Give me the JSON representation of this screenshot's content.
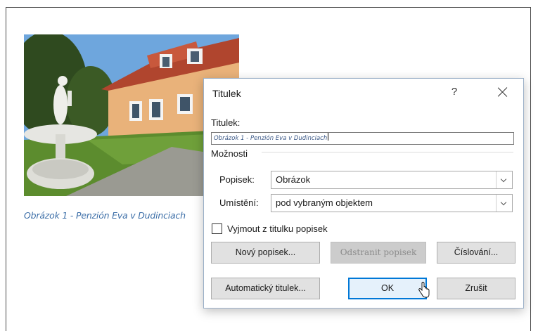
{
  "document": {
    "caption": "Obrázok 1 - Penzión Eva v Dudinciach"
  },
  "dialog": {
    "title": "Titulek",
    "help": "?",
    "caption_label": "Titulek:",
    "caption_value": "Obrázok 1 - Penzión Eva v Dudinciach",
    "options_label": "Možnosti",
    "label_field": {
      "label": "Popisek:",
      "value": "Obrázok"
    },
    "position_field": {
      "label": "Umístění:",
      "value": "pod vybraným objektem"
    },
    "exclude_label": {
      "label": "Vyjmout z titulku popisek",
      "checked": false
    },
    "buttons": {
      "new_label": "Nový popisek...",
      "delete_label": "Odstranit popisek",
      "numbering": "Číslování...",
      "autocaption": "Automatický titulek...",
      "ok": "OK",
      "cancel": "Zrušit"
    }
  }
}
